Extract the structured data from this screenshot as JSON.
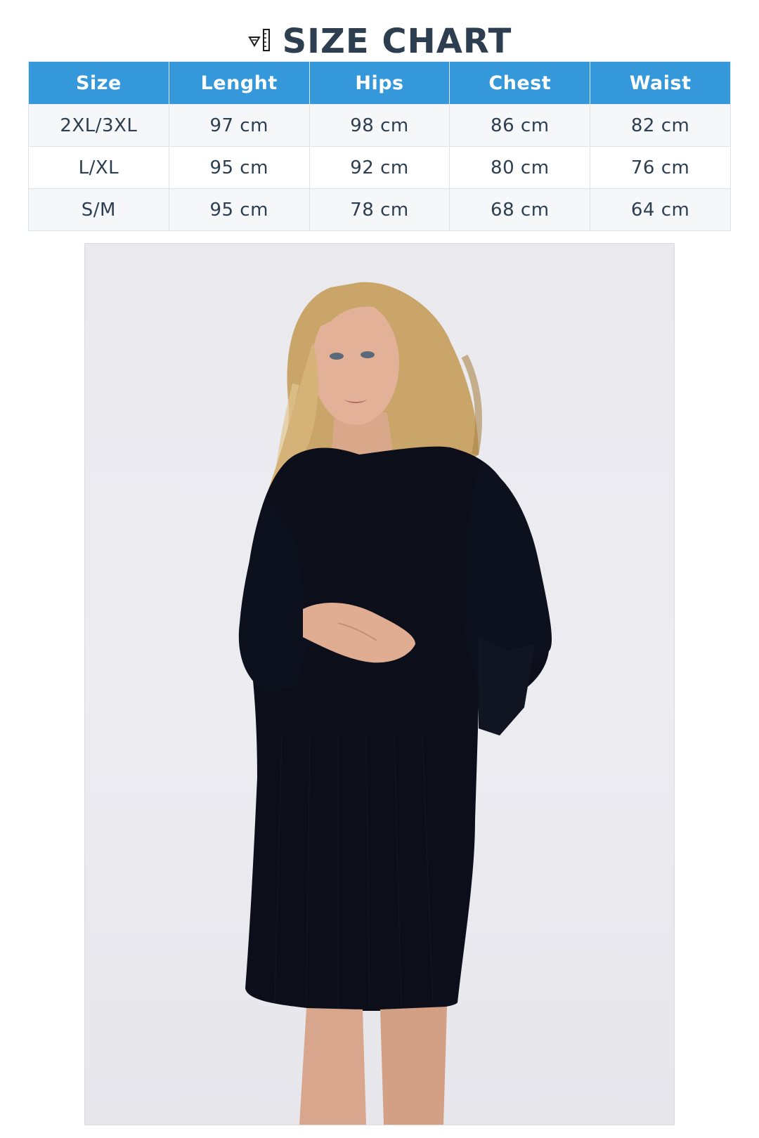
{
  "title": {
    "icon": "ruler-icon",
    "text": "SIZE CHART"
  },
  "table": {
    "headers": [
      "Size",
      "Lenght",
      "Hips",
      "Chest",
      "Waist"
    ],
    "rows": [
      [
        "2XL/3XL",
        "97 cm",
        "98 cm",
        "86 cm",
        "82 cm"
      ],
      [
        "L/XL",
        "95 cm",
        "92 cm",
        "80 cm",
        "76 cm"
      ],
      [
        "S/M",
        "95 cm",
        "78 cm",
        "68 cm",
        "64 cm"
      ]
    ]
  },
  "colors": {
    "header_bg": "#3498db",
    "header_text": "#ffffff",
    "title_text": "#2c3e50",
    "body_text": "#2c3e50",
    "stripe": "#f6f7f9"
  },
  "photo": {
    "subject": "model-photo"
  }
}
